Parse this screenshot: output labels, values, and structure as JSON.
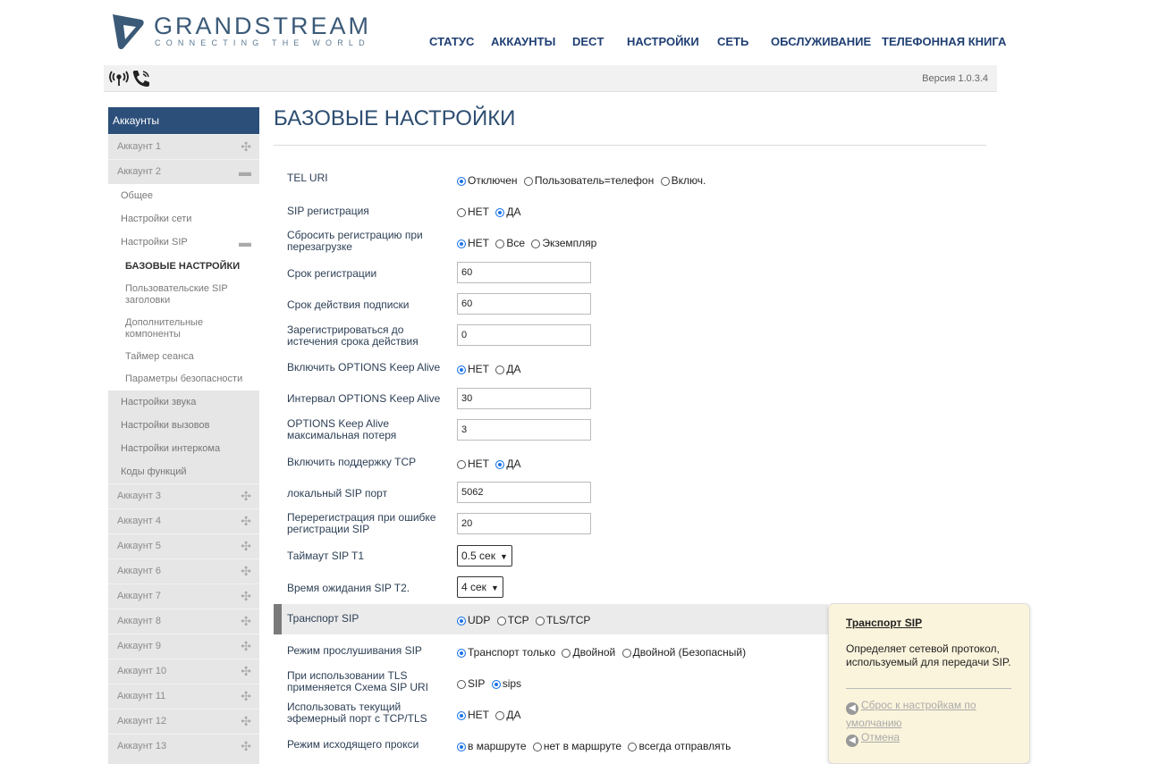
{
  "brand": {
    "name": "GRANDSTREAM",
    "tagline": "CONNECTING THE WORLD"
  },
  "nav": [
    "СТАТУС",
    "АККАУНТЫ",
    "DECT",
    "НАСТРОЙКИ",
    "СЕТЬ",
    "ОБСЛУЖИВАНИЕ",
    "ТЕЛЕФОННАЯ КНИГА"
  ],
  "statusbar": {
    "version": "Версия 1.0.3.4",
    "icons": [
      "antenna-icon",
      "phone-icon"
    ]
  },
  "sidebar": {
    "header": "Аккаунты",
    "account1": "Аккаунт 1",
    "account2": "Аккаунт 2",
    "sub": [
      "Общее",
      "Настройки сети",
      "Настройки SIP"
    ],
    "sip_sub": [
      "БАЗОВЫЕ НАСТРОЙКИ",
      "Пользовательские SIP заголовки",
      "Дополнительные компоненты",
      "Таймер сеанса",
      "Параметры безопасности"
    ],
    "sub2": [
      "Настройки звука",
      "Настройки вызовов",
      "Настройки интеркома",
      "Коды функций"
    ],
    "accounts_rest": [
      "Аккаунт 3",
      "Аккаунт 4",
      "Аккаунт 5",
      "Аккаунт 6",
      "Аккаунт 7",
      "Аккаунт 8",
      "Аккаунт 9",
      "Аккаунт 10",
      "Аккаунт 11",
      "Аккаунт 12",
      "Аккаунт 13"
    ]
  },
  "page": {
    "title": "БАЗОВЫЕ НАСТРОЙКИ"
  },
  "form": {
    "tel_uri": {
      "label": "TEL URI",
      "options": [
        "Отключен",
        "Пользователь=телефон",
        "Включ."
      ],
      "selected": 0
    },
    "sip_reg": {
      "label": "SIP регистрация",
      "options": [
        "НЕТ",
        "ДА"
      ],
      "selected": 1
    },
    "reset_reg": {
      "label": "Сбросить регистрацию при перезагрузке",
      "options": [
        "НЕТ",
        "Все",
        "Экземпляр"
      ],
      "selected": 0
    },
    "reg_expiry": {
      "label": "Срок регистрации",
      "value": "60"
    },
    "sub_expiry": {
      "label": "Срок действия подписки",
      "value": "60"
    },
    "reregister_before": {
      "label": "Зарегистрироваться до истечения срока действия",
      "value": "0"
    },
    "options_keepalive": {
      "label": "Включить OPTIONS Keep Alive",
      "options": [
        "НЕТ",
        "ДА"
      ],
      "selected": 0
    },
    "options_interval": {
      "label": "Интервал OPTIONS Keep Alive",
      "value": "30"
    },
    "options_maxloss": {
      "label": "OPTIONS Keep Alive максимальная потеря",
      "value": "3"
    },
    "tcp_support": {
      "label": "Включить поддержку TCP",
      "options": [
        "НЕТ",
        "ДА"
      ],
      "selected": 1
    },
    "local_sip_port": {
      "label": "локальный SIP порт",
      "value": "5062"
    },
    "rereg_on_error": {
      "label": "Перерегистрация при ошибке регистрации SIP",
      "value": "20"
    },
    "sip_t1": {
      "label": "Таймаут SIP T1",
      "value": "0.5 сек"
    },
    "sip_t2": {
      "label": "Время ожидания SIP T2.",
      "value": "4 сек"
    },
    "sip_transport": {
      "label": "Транспорт SIP",
      "options": [
        "UDP",
        "TCP",
        "TLS/TCP"
      ],
      "selected": 0
    },
    "listen_mode": {
      "label": "Режим прослушивания SIP",
      "options": [
        "Транспорт только",
        "Двойной",
        "Двойной (Безопасный)"
      ],
      "selected": 0
    },
    "tls_scheme": {
      "label": "При использовании TLS применяется Схема SIP URI",
      "options": [
        "SIP",
        "sips"
      ],
      "selected": 1
    },
    "ephemeral_port": {
      "label": "Использовать текущий эфемерный порт с TCP/TLS",
      "options": [
        "НЕТ",
        "ДА"
      ],
      "selected": 0
    },
    "outbound_proxy": {
      "label": "Режим исходящего прокси",
      "options": [
        "в маршруте",
        "нет в маршруте",
        "всегда отправлять"
      ],
      "selected": 0
    }
  },
  "tooltip": {
    "title": "Транспорт SIP",
    "body": "Определяет сетевой протокол, используемый для передачи SIP.",
    "reset": "Сброс к настройкам по умолчанию",
    "cancel": "Отмена"
  }
}
